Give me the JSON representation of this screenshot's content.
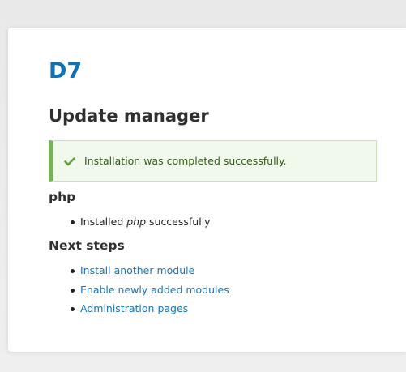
{
  "site": {
    "name": "D7"
  },
  "page": {
    "title": "Update manager"
  },
  "status": {
    "message": "Installation was completed successfully.",
    "icon": "check-icon",
    "accent_color": "#77b259"
  },
  "project": {
    "heading": "php",
    "results": [
      {
        "prefix": "Installed ",
        "name": "php",
        "suffix": " successfully"
      }
    ]
  },
  "next_steps": {
    "heading": "Next steps",
    "links": [
      "Install another module",
      "Enable newly added modules",
      "Administration pages"
    ]
  },
  "colors": {
    "link": "#1577b8",
    "site_name": "#0e72b5",
    "status_bg": "#f1f8ec"
  }
}
